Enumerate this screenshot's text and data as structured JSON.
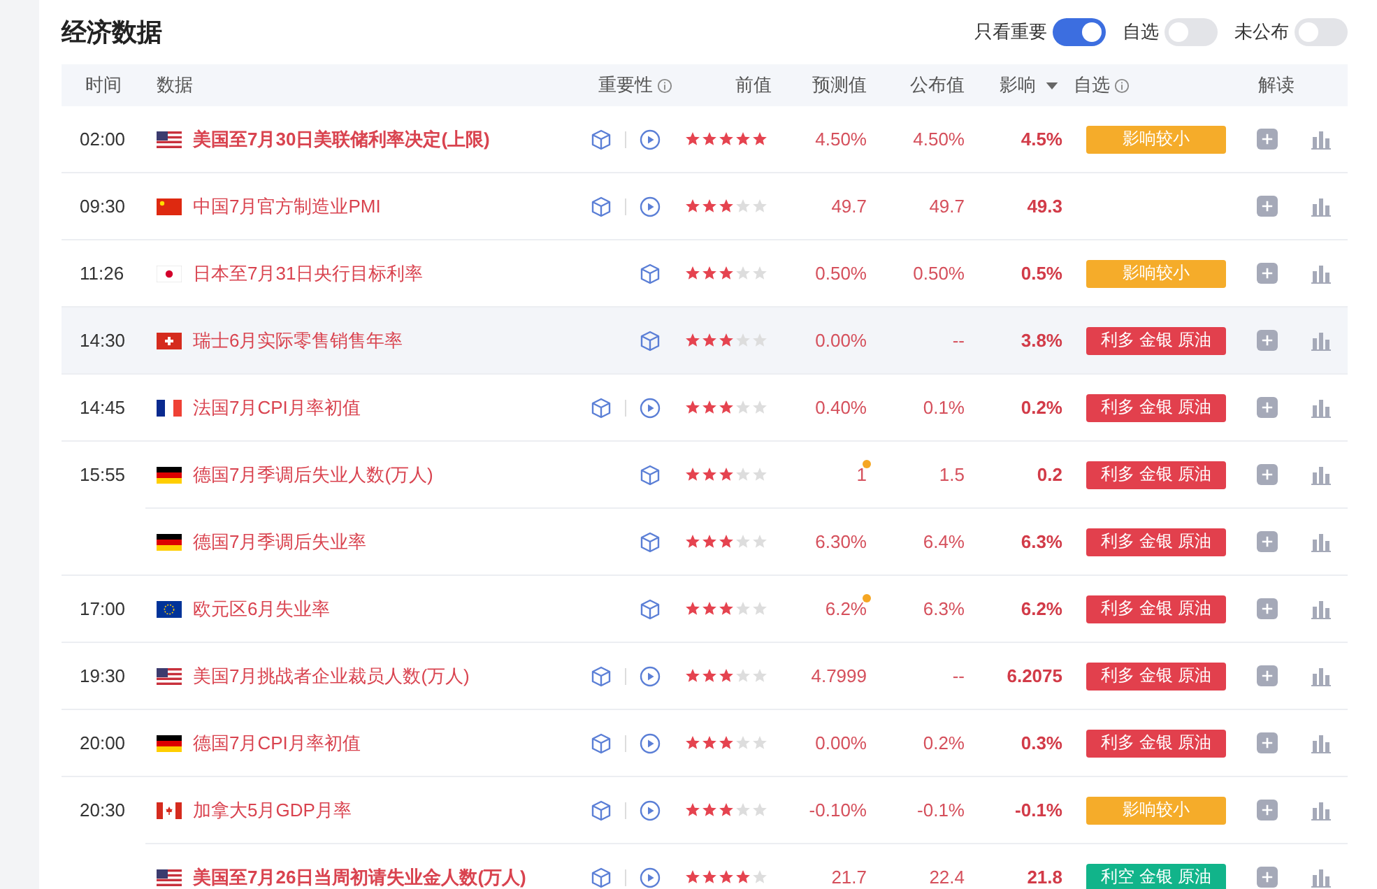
{
  "title": "经济数据",
  "filters": [
    {
      "label": "只看重要",
      "on": true
    },
    {
      "label": "自选",
      "on": false
    },
    {
      "label": "未公布",
      "on": false
    }
  ],
  "columns": [
    {
      "label": "时间",
      "info": false,
      "dropdown": false
    },
    {
      "label": "数据",
      "info": false,
      "dropdown": false
    },
    {
      "label": "重要性",
      "info": true,
      "dropdown": false
    },
    {
      "label": "前值",
      "info": false,
      "dropdown": false
    },
    {
      "label": "预测值",
      "info": false,
      "dropdown": false
    },
    {
      "label": "公布值",
      "info": false,
      "dropdown": false
    },
    {
      "label": "影响",
      "info": false,
      "dropdown": true
    },
    {
      "label": "自选",
      "info": true,
      "dropdown": false
    },
    {
      "label": "解读",
      "info": false,
      "dropdown": false
    }
  ],
  "rows": [
    {
      "time": "02:00",
      "flag": {
        "kind": "us"
      },
      "name": "美国至7月30日美联储利率决定(上限)",
      "important": true,
      "video": true,
      "stars": 5,
      "previous": "4.50%",
      "revised": false,
      "forecast": "4.50%",
      "actual": "4.5%",
      "impact": {
        "kind": "minor",
        "text": "影响较小"
      },
      "selected": false
    },
    {
      "time": "09:30",
      "flag": {
        "kind": "cn"
      },
      "name": "中国7月官方制造业PMI",
      "important": false,
      "video": true,
      "stars": 3,
      "previous": "49.7",
      "revised": false,
      "forecast": "49.7",
      "actual": "49.3",
      "selected": false
    },
    {
      "time": "11:26",
      "flag": {
        "kind": "jp"
      },
      "name": "日本至7月31日央行目标利率",
      "important": false,
      "video": false,
      "stars": 3,
      "previous": "0.50%",
      "revised": false,
      "forecast": "0.50%",
      "actual": "0.5%",
      "impact": {
        "kind": "minor",
        "text": "影响较小"
      },
      "selected": false
    },
    {
      "time": "14:30",
      "flag": {
        "kind": "ch"
      },
      "name": "瑞士6月实际零售销售年率",
      "important": false,
      "video": false,
      "stars": 3,
      "previous": "0.00%",
      "revised": false,
      "forecast": "--",
      "actual": "3.8%",
      "impact": {
        "kind": "bullish",
        "text": "利多 金银 原油"
      },
      "selected": true
    },
    {
      "time": "14:45",
      "flag": {
        "kind": "fr"
      },
      "name": "法国7月CPI月率初值",
      "important": false,
      "video": true,
      "stars": 3,
      "previous": "0.40%",
      "revised": false,
      "forecast": "0.1%",
      "actual": "0.2%",
      "impact": {
        "kind": "bullish",
        "text": "利多 金银 原油"
      },
      "selected": false
    },
    {
      "time": "15:55",
      "flag": {
        "kind": "de"
      },
      "name": "德国7月季调后失业人数(万人)",
      "important": false,
      "video": false,
      "stars": 3,
      "previous": "1",
      "revised": true,
      "forecast": "1.5",
      "actual": "0.2",
      "impact": {
        "kind": "bullish",
        "text": "利多 金银 原油"
      },
      "selected": false
    },
    {
      "flag": {
        "kind": "de"
      },
      "name": "德国7月季调后失业率",
      "important": false,
      "video": false,
      "stars": 3,
      "previous": "6.30%",
      "revised": false,
      "forecast": "6.4%",
      "actual": "6.3%",
      "impact": {
        "kind": "bullish",
        "text": "利多 金银 原油"
      },
      "selected": false
    },
    {
      "time": "17:00",
      "flag": {
        "kind": "eu"
      },
      "name": "欧元区6月失业率",
      "important": false,
      "video": false,
      "stars": 3,
      "previous": "6.2%",
      "revised": true,
      "forecast": "6.3%",
      "actual": "6.2%",
      "impact": {
        "kind": "bullish",
        "text": "利多 金银 原油"
      },
      "selected": false
    },
    {
      "time": "19:30",
      "flag": {
        "kind": "us"
      },
      "name": "美国7月挑战者企业裁员人数(万人)",
      "important": false,
      "video": true,
      "stars": 3,
      "previous": "4.7999",
      "revised": false,
      "forecast": "--",
      "actual": "6.2075",
      "impact": {
        "kind": "bullish",
        "text": "利多 金银 原油"
      },
      "selected": false
    },
    {
      "time": "20:00",
      "flag": {
        "kind": "de"
      },
      "name": "德国7月CPI月率初值",
      "important": false,
      "video": true,
      "stars": 3,
      "previous": "0.00%",
      "revised": false,
      "forecast": "0.2%",
      "actual": "0.3%",
      "impact": {
        "kind": "bullish",
        "text": "利多 金银 原油"
      },
      "selected": false
    },
    {
      "time": "20:30",
      "flag": {
        "kind": "ca"
      },
      "name": "加拿大5月GDP月率",
      "important": false,
      "video": true,
      "stars": 3,
      "previous": "-0.10%",
      "revised": false,
      "forecast": "-0.1%",
      "actual": "-0.1%",
      "impact": {
        "kind": "minor",
        "text": "影响较小"
      },
      "selected": false
    },
    {
      "flag": {
        "kind": "us"
      },
      "name": "美国至7月26日当周初请失业金人数(万人)",
      "important": true,
      "video": true,
      "stars": 4,
      "previous": "21.7",
      "revised": false,
      "forecast": "22.4",
      "actual": "21.8",
      "impact": {
        "kind": "bearish",
        "text": "利空 金银 原油"
      },
      "selected": false
    }
  ]
}
